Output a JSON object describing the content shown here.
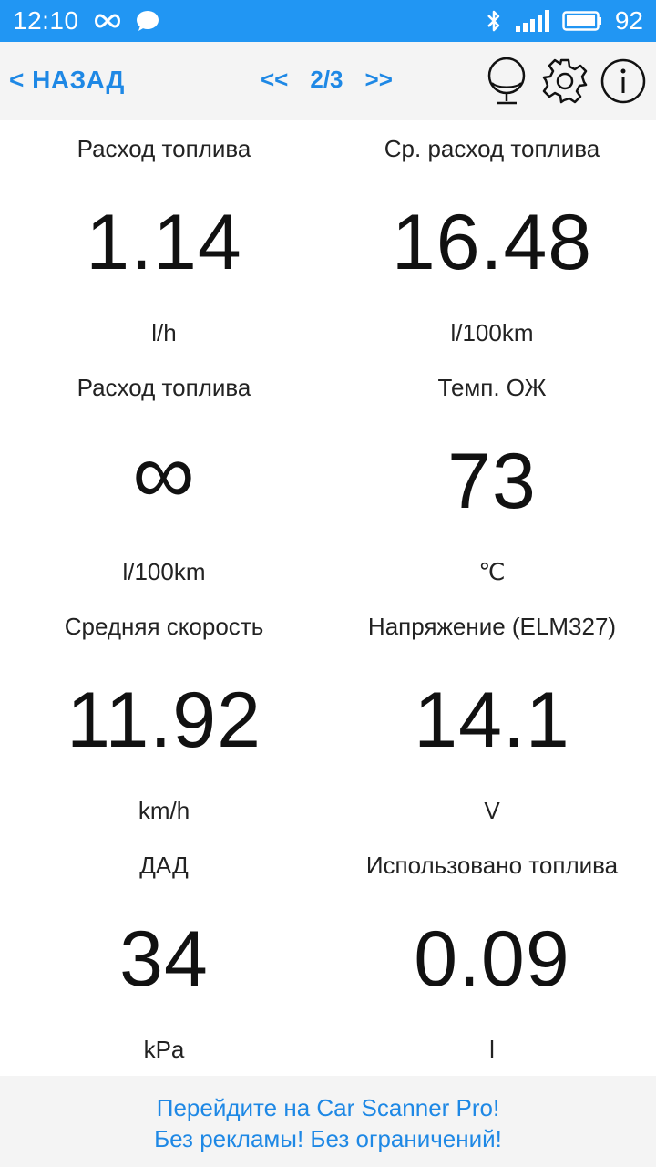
{
  "status_bar": {
    "time": "12:10",
    "battery": "92",
    "icons": [
      "infinity-icon",
      "chat-bubble-icon",
      "bluetooth-icon",
      "signal-icon",
      "battery-icon"
    ],
    "background": "#2196F3"
  },
  "nav": {
    "back_label": "< НАЗАД",
    "prev_label": "<<",
    "page": "2/3",
    "next_label": ">>",
    "icons": [
      "gauge-globe-icon",
      "gear-icon",
      "info-icon"
    ],
    "accent": "#1e88e5"
  },
  "gauges": [
    {
      "title": "Расход топлива",
      "value": "1.14",
      "unit": "l/h"
    },
    {
      "title": "Ср. расход топлива",
      "value": "16.48",
      "unit": "l/100km"
    },
    {
      "title": "Расход топлива",
      "value": "∞",
      "unit": "l/100km"
    },
    {
      "title": "Темп. ОЖ",
      "value": "73",
      "unit": "℃"
    },
    {
      "title": "Средняя скорость",
      "value": "11.92",
      "unit": "km/h"
    },
    {
      "title": "Напряжение (ELM327)",
      "value": "14.1",
      "unit": "V"
    },
    {
      "title": "ДАД",
      "value": "34",
      "unit": "kPa"
    },
    {
      "title": "Использовано топлива",
      "value": "0.09",
      "unit": "l"
    }
  ],
  "promo": {
    "line1": "Перейдите на Car Scanner Pro!",
    "line2": "Без рекламы! Без ограничений!"
  }
}
